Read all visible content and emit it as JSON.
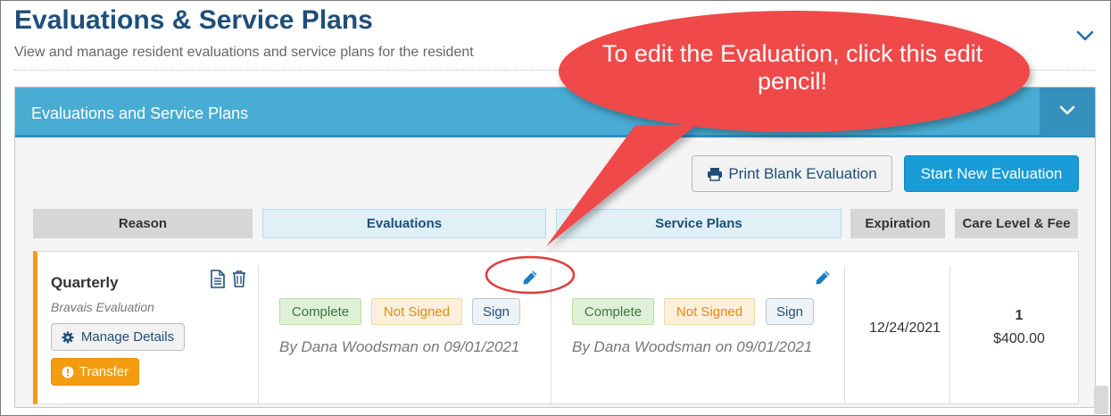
{
  "header": {
    "title": "Evaluations & Service Plans",
    "subtitle": "View and manage resident evaluations and service plans for the resident",
    "collapse_icon": "chevron-down-icon"
  },
  "panel": {
    "title": "Evaluations and Service Plans",
    "toggle_icon": "chevron-down-icon",
    "print_button": "Print Blank Evaluation",
    "start_button": "Start New Evaluation"
  },
  "columns": {
    "reason": "Reason",
    "evaluations": "Evaluations",
    "service_plans": "Service Plans",
    "expiration": "Expiration",
    "care": "Care Level & Fee"
  },
  "row": {
    "reason_title": "Quarterly",
    "reason_subtitle": "Bravais Evaluation",
    "manage_button": "Manage Details",
    "transfer_button": "Transfer",
    "evaluation": {
      "status": "Complete",
      "signature_status": "Not Signed",
      "sign_button": "Sign",
      "byline": "By Dana Woodsman on 09/01/2021"
    },
    "service_plan": {
      "status": "Complete",
      "signature_status": "Not Signed",
      "sign_button": "Sign",
      "byline": "By Dana Woodsman on 09/01/2021"
    },
    "expiration": "12/24/2021",
    "care_level": "1",
    "fee": "$400.00"
  },
  "callout": {
    "text": "To edit the Evaluation, click this edit pencil!",
    "color": "#f04a4a"
  },
  "colors": {
    "title": "#1f4e79",
    "panel_header": "#48acd3",
    "primary_button": "#1a9cd6",
    "accent_orange": "#f39c12",
    "success_green": "#3c763d"
  }
}
